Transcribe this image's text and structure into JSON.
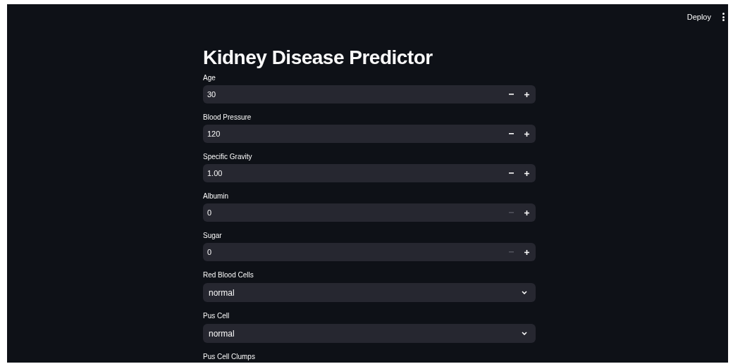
{
  "header": {
    "deploy": "Deploy"
  },
  "title": "Kidney Disease Predictor",
  "fields": [
    {
      "kind": "number",
      "label": "Age",
      "value": "30",
      "minus_disabled": false
    },
    {
      "kind": "number",
      "label": "Blood Pressure",
      "value": "120",
      "minus_disabled": false
    },
    {
      "kind": "number",
      "label": "Specific Gravity",
      "value": "1.00",
      "minus_disabled": false
    },
    {
      "kind": "number",
      "label": "Albumin",
      "value": "0",
      "minus_disabled": true
    },
    {
      "kind": "number",
      "label": "Sugar",
      "value": "0",
      "minus_disabled": true
    },
    {
      "kind": "select",
      "label": "Red Blood Cells",
      "value": "normal"
    },
    {
      "kind": "select",
      "label": "Pus Cell",
      "value": "normal"
    },
    {
      "kind": "label",
      "label": "Pus Cell Clumps"
    }
  ]
}
